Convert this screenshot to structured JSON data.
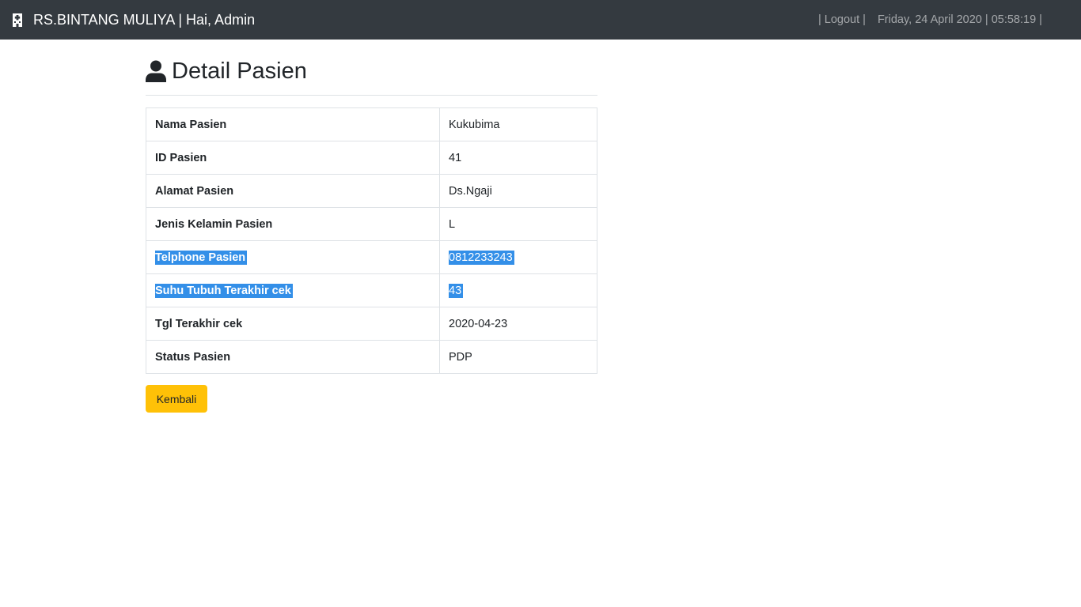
{
  "navbar": {
    "brand": "RS.BINTANG MULIYA | Hai, Admin",
    "brand_icon": "hospital-icon",
    "logout": "| Logout |",
    "datetime": "Friday, 24 April 2020 | 05:58:19 |"
  },
  "page": {
    "title": "Detail Pasien",
    "title_icon": "user-icon"
  },
  "rows": [
    {
      "label": "Nama Pasien",
      "value": "Kukubima"
    },
    {
      "label": "ID Pasien",
      "value": "41"
    },
    {
      "label": "Alamat Pasien",
      "value": "Ds.Ngaji"
    },
    {
      "label": "Jenis Kelamin Pasien",
      "value": "L"
    },
    {
      "label": "Telphone Pasien",
      "value": "0812233243"
    },
    {
      "label": "Suhu Tubuh Terakhir cek",
      "value": "43"
    },
    {
      "label": "Tgl Terakhir cek",
      "value": "2020-04-23"
    },
    {
      "label": "Status Pasien",
      "value": "PDP"
    }
  ],
  "button": {
    "back_label": "Kembali"
  },
  "colors": {
    "navbar": "#343a40",
    "button": "#ffc107",
    "selection": "#338fe8"
  }
}
